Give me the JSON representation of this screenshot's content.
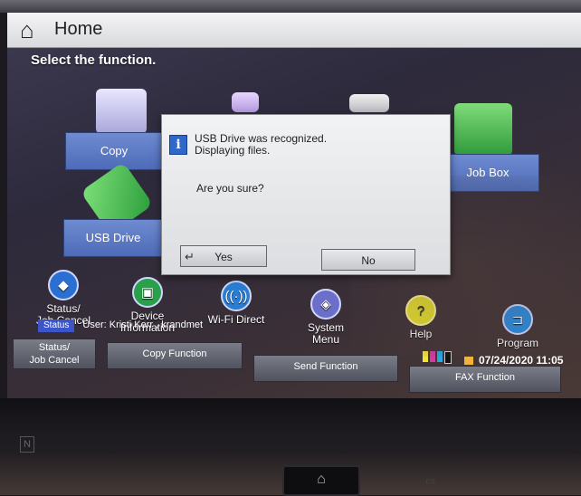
{
  "header": {
    "title": "Home",
    "subtitle": "Select the function."
  },
  "tiles": {
    "copy": "Copy",
    "usb": "USB Drive",
    "job_box": "Job Box"
  },
  "dialog": {
    "line1": "USB Drive was recognized.",
    "line2": "Displaying files.",
    "question": "Are you sure?",
    "yes": "Yes",
    "no": "No"
  },
  "functions": {
    "status_job_cancel": "Status/\nJob Cancel",
    "device_information": "Device\nInformation",
    "wifi_direct": "Wi-Fi Direct",
    "system_menu": "System\nMenu",
    "help": "Help",
    "program": "Program"
  },
  "status_bar": {
    "tag": "Status",
    "user": "User: Kristi Kerr , krandmet",
    "datetime": "07/24/2020  11:05"
  },
  "bottom_buttons": {
    "status_job_cancel": "Status/\nJob Cancel",
    "copy_function": "Copy Function",
    "send_function": "Send Function",
    "fax_function": "FAX Function"
  },
  "icons": {
    "home": "home-icon",
    "info": "info-icon",
    "status": "status-icon",
    "device": "device-info-icon",
    "wifi": "wifi-icon",
    "system": "system-menu-icon",
    "help": "help-icon",
    "program": "program-icon"
  },
  "colors": {
    "tile_blue": "#5b77c2",
    "status_tag": "#3b55c9",
    "help_yellow": "#e6e02f",
    "device_green": "#2aa04a"
  }
}
